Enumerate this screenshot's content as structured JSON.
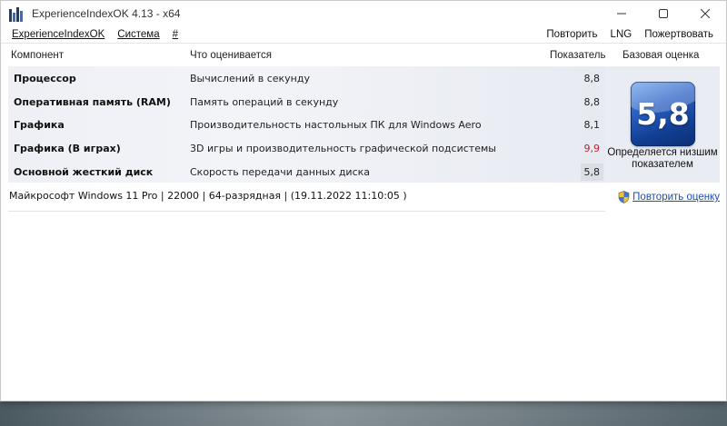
{
  "window": {
    "title": "ExperienceIndexOK 4.13 - x64"
  },
  "menu": {
    "left": [
      "ExperienceIndexOK",
      "Система",
      "#"
    ],
    "right": [
      "Повторить",
      "LNG",
      "Пожертвовать"
    ]
  },
  "table": {
    "headers": {
      "component": "Компонент",
      "what": "Что оценивается",
      "score": "Показатель",
      "base": "Базовая оценка"
    },
    "rows": [
      {
        "name": "Процессор",
        "desc": "Вычислений в секунду",
        "value": "8,8"
      },
      {
        "name": "Оперативная память (RAM)",
        "desc": "Память операций в секунду",
        "value": "8,8"
      },
      {
        "name": "Графика",
        "desc": "Производительность настольных ПК для Windows Aero",
        "value": "8,1"
      },
      {
        "name": "Графика (В играх)",
        "desc": "3D игры и производительность графической подсистемы",
        "value": "9,9"
      },
      {
        "name": "Основной жесткий диск",
        "desc": "Скорость передачи данных диска",
        "value": "5,8"
      }
    ]
  },
  "base_score": {
    "value": "5,8",
    "caption_line1": "Определяется низшим",
    "caption_line2": "показателем"
  },
  "status": {
    "sysinfo": "Майкрософт Windows 11 Pro | 22000 | 64-разрядная | (19.11.2022 11:10:05 )",
    "repeat_link": "Повторить оценку"
  },
  "colors": {
    "highlight_value": "#c0232b",
    "link": "#1a4fb5",
    "badge": "#2c63c6"
  },
  "icons": {
    "app": "app-bars-icon",
    "minimize": "minimize-icon",
    "maximize": "maximize-icon",
    "close": "close-icon",
    "shield": "shield-icon"
  }
}
